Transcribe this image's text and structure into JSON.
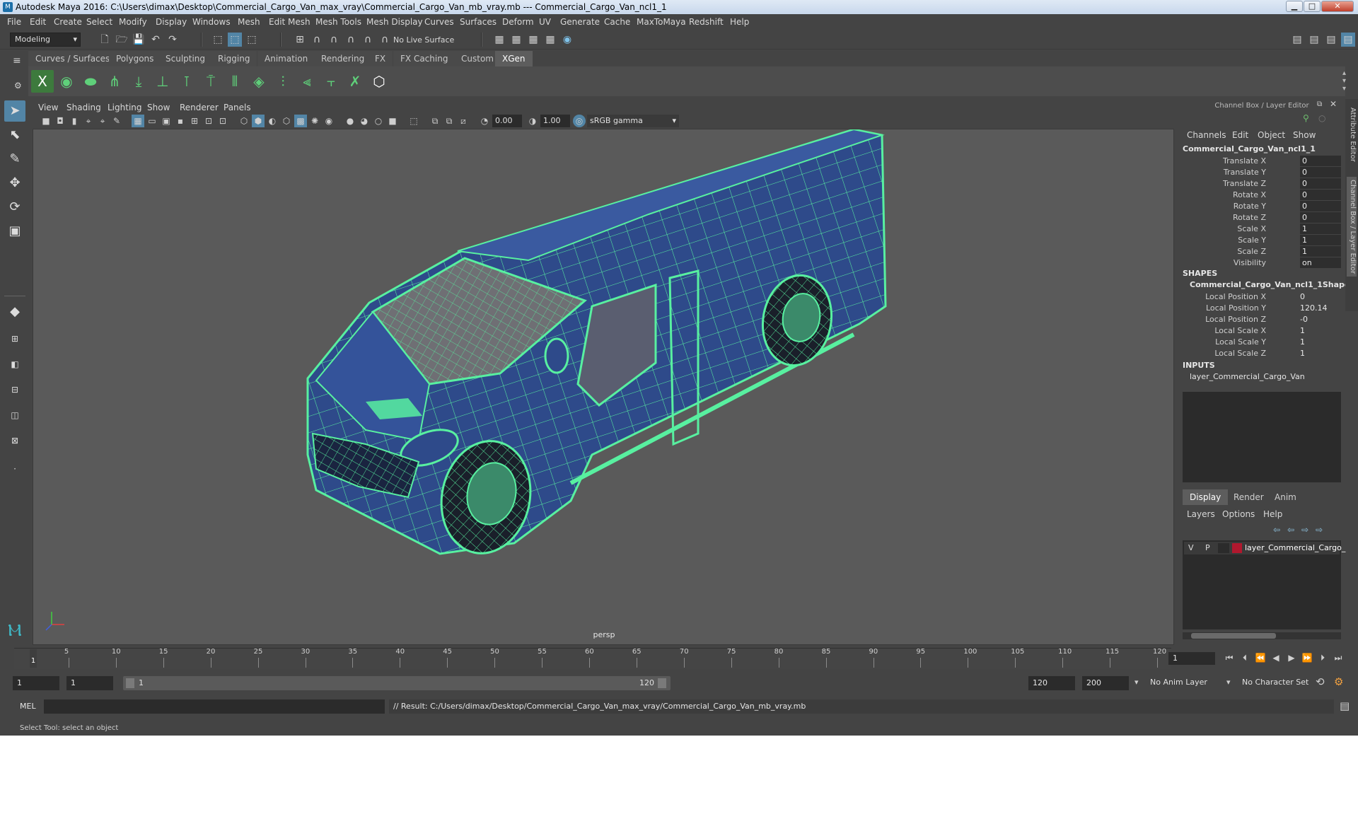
{
  "titlebar": {
    "title": "Autodesk Maya 2016: C:\\Users\\dimax\\Desktop\\Commercial_Cargo_Van_max_vray\\Commercial_Cargo_Van_mb_vray.mb   ---   Commercial_Cargo_Van_ncl1_1"
  },
  "menubar": [
    "File",
    "Edit",
    "Create",
    "Select",
    "Modify",
    "Display",
    "Windows",
    "Mesh",
    "Edit Mesh",
    "Mesh Tools",
    "Mesh Display",
    "Curves",
    "Surfaces",
    "Deform",
    "UV",
    "Generate",
    "Cache",
    "MaxToMaya",
    "Redshift",
    "Help"
  ],
  "statusline": {
    "mode": "Modeling",
    "live_surface": "No Live Surface"
  },
  "shelf": {
    "tabs": [
      "Curves / Surfaces",
      "Polygons",
      "Sculpting",
      "Rigging",
      "Animation",
      "Rendering",
      "FX",
      "FX Caching",
      "Custom",
      "XGen"
    ],
    "active_tab": "XGen"
  },
  "viewport": {
    "menus": [
      "View",
      "Shading",
      "Lighting",
      "Show",
      "Renderer",
      "Panels"
    ],
    "exposure": "0.00",
    "gamma": "1.00",
    "color_space": "sRGB gamma",
    "camera": "persp"
  },
  "channel_box": {
    "title": "Channel Box / Layer Editor",
    "menus": [
      "Channels",
      "Edit",
      "Object",
      "Show"
    ],
    "object_name": "Commercial_Cargo_Van_ncl1_1",
    "channels": [
      {
        "label": "Translate X",
        "value": "0"
      },
      {
        "label": "Translate Y",
        "value": "0"
      },
      {
        "label": "Translate Z",
        "value": "0"
      },
      {
        "label": "Rotate X",
        "value": "0"
      },
      {
        "label": "Rotate Y",
        "value": "0"
      },
      {
        "label": "Rotate Z",
        "value": "0"
      },
      {
        "label": "Scale X",
        "value": "1"
      },
      {
        "label": "Scale Y",
        "value": "1"
      },
      {
        "label": "Scale Z",
        "value": "1"
      },
      {
        "label": "Visibility",
        "value": "on"
      }
    ],
    "shapes_header": "SHAPES",
    "shape_name": "Commercial_Cargo_Van_ncl1_1Shape",
    "shape_channels": [
      {
        "label": "Local Position X",
        "value": "0"
      },
      {
        "label": "Local Position Y",
        "value": "120.14"
      },
      {
        "label": "Local Position Z",
        "value": "-0"
      },
      {
        "label": "Local Scale X",
        "value": "1"
      },
      {
        "label": "Local Scale Y",
        "value": "1"
      },
      {
        "label": "Local Scale Z",
        "value": "1"
      }
    ],
    "inputs_header": "INPUTS",
    "input_name": "layer_Commercial_Cargo_Van"
  },
  "layer_editor": {
    "tabs": [
      "Display",
      "Render",
      "Anim"
    ],
    "active_tab": "Display",
    "menus": [
      "Layers",
      "Options",
      "Help"
    ],
    "layer": {
      "v": "V",
      "p": "P",
      "color": "#b0182e",
      "name": "layer_Commercial_Cargo_"
    }
  },
  "side_tabs": [
    "Attribute Editor",
    "Channel Box / Layer Editor"
  ],
  "timeline": {
    "ticks": [
      "5",
      "10",
      "15",
      "20",
      "25",
      "30",
      "35",
      "40",
      "45",
      "50",
      "55",
      "60",
      "65",
      "70",
      "75",
      "80",
      "85",
      "90",
      "95",
      "100",
      "105",
      "110",
      "115",
      "120"
    ],
    "current_frame": "1",
    "current_frame_field": "1"
  },
  "range": {
    "start": "1",
    "playback_start": "1",
    "bar_start": "1",
    "bar_end": "120",
    "playback_end": "120",
    "end": "200",
    "anim_layer": "No Anim Layer",
    "character_set": "No Character Set"
  },
  "command_line": {
    "language": "MEL",
    "result": "// Result: C:/Users/dimax/Desktop/Commercial_Cargo_Van_max_vray/Commercial_Cargo_Van_mb_vray.mb"
  },
  "help_line": "Select Tool: select an object",
  "colors": {
    "wire": "#58f0a0",
    "van_body": "#2e4a8a",
    "accent": "#5285a6"
  }
}
